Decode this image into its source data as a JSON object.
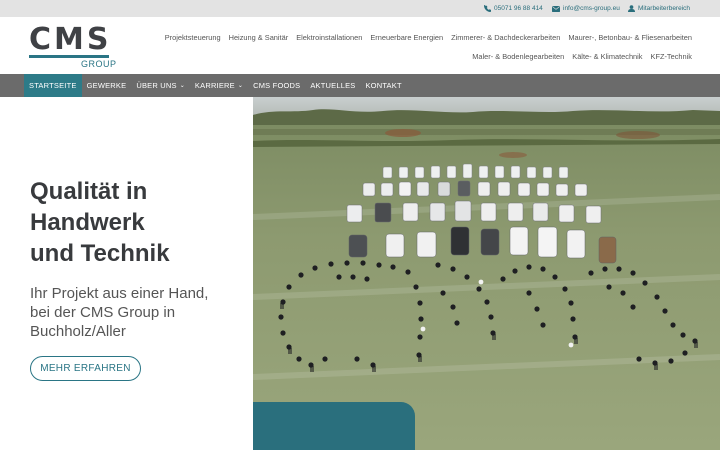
{
  "topbar": {
    "phone": "05071 96 88 414",
    "email": "info@cms-group.eu",
    "staff": "Mitarbeiterbereich"
  },
  "logo": {
    "main": "CMS",
    "sub": "GROUP"
  },
  "services_row1": [
    "Projektsteuerung",
    "Heizung & Sanitär",
    "Elektroinstallationen",
    "Erneuerbare Energien",
    "Zimmerer- & Dachdeckerarbeiten",
    "Maurer-, Betonbau- & Fliesenarbeiten"
  ],
  "services_row2": [
    "Maler- & Bodenlegearbeiten",
    "Kälte- & Klimatechnik",
    "KFZ-Technik"
  ],
  "nav": {
    "items": [
      {
        "label": "STARTSEITE",
        "active": true
      },
      {
        "label": "GEWERKE"
      },
      {
        "label": "ÜBER UNS",
        "dropdown": true
      },
      {
        "label": "KARRIERE",
        "dropdown": true
      },
      {
        "label": "CMS FOODS"
      },
      {
        "label": "AKTUELLES"
      },
      {
        "label": "KONTAKT"
      }
    ]
  },
  "hero": {
    "title_lines": [
      "Qualität in",
      "Handwerk",
      "und Technik"
    ],
    "subtitle_lines": [
      "Ihr Projekt aus einer Hand,",
      "bei der CMS Group in",
      "Buchholz/Aller"
    ],
    "cta": "MEHR ERFAHREN"
  },
  "colors": {
    "accent": "#2a7585",
    "nav_bg": "#6b6b6b",
    "nav_active": "#2d7b88",
    "topbar_bg": "#e3e3e3",
    "text_dark": "#383a3d"
  }
}
